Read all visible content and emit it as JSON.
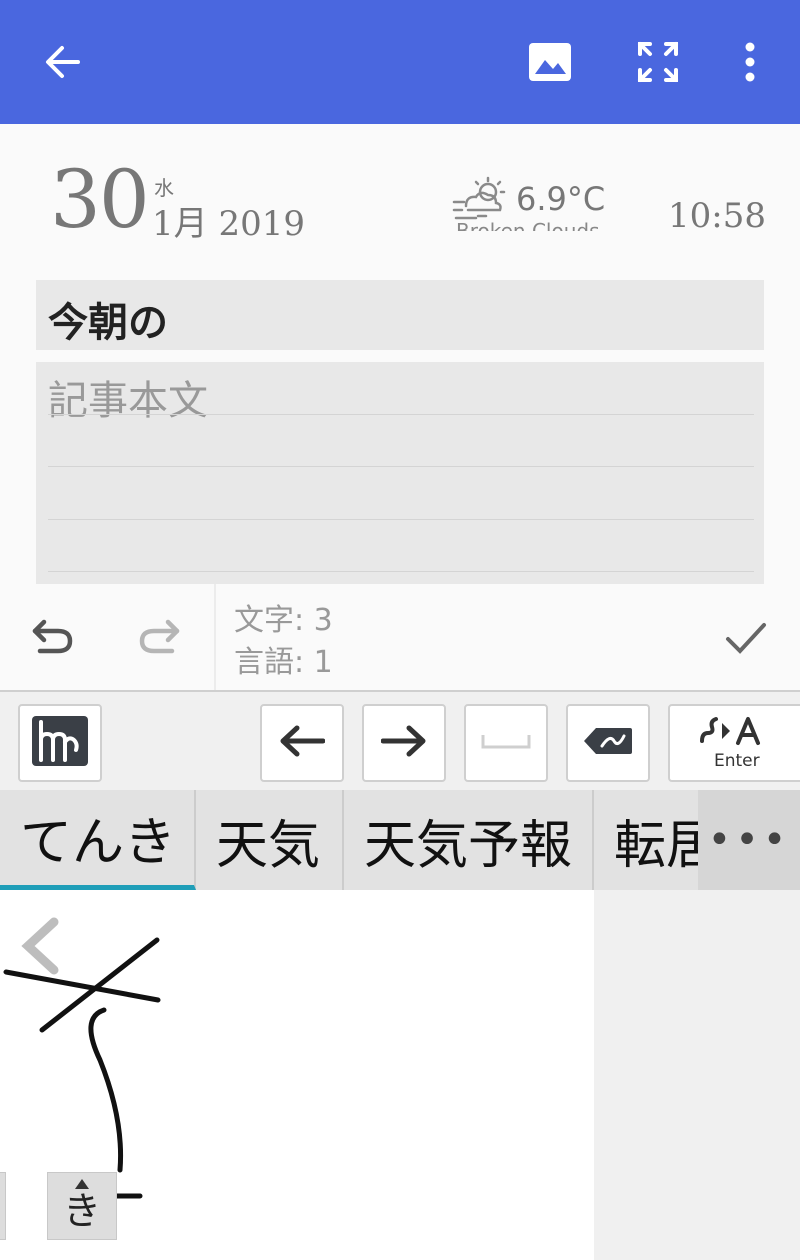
{
  "app_bar": {
    "icons": [
      "back-arrow-icon",
      "image-icon",
      "fullscreen-icon",
      "more-vert-icon"
    ],
    "background": "#4a67df"
  },
  "header": {
    "day": "30",
    "weekday": "水",
    "month_year": "1月 2019",
    "temperature": "6.9°C",
    "condition": "Broken Clouds",
    "time": "10:58",
    "weather_icon": "partly-cloudy-windy-icon"
  },
  "editor": {
    "title_value": "今朝の",
    "body_placeholder": "記事本文",
    "char_count": "文字: 3",
    "word_count": "言語: 1"
  },
  "keyboard": {
    "toolbar": {
      "enter_label": "Enter",
      "icons": [
        "handwriting-mode-icon",
        "left-arrow-icon",
        "right-arrow-icon",
        "space-icon",
        "backspace-icon",
        "enter-convert-icon"
      ]
    },
    "candidates": [
      "てんき",
      "天気",
      "天気予報",
      "転居"
    ],
    "more_label": "•••",
    "recognized_char": "き",
    "accent": "#1f9eb8"
  }
}
